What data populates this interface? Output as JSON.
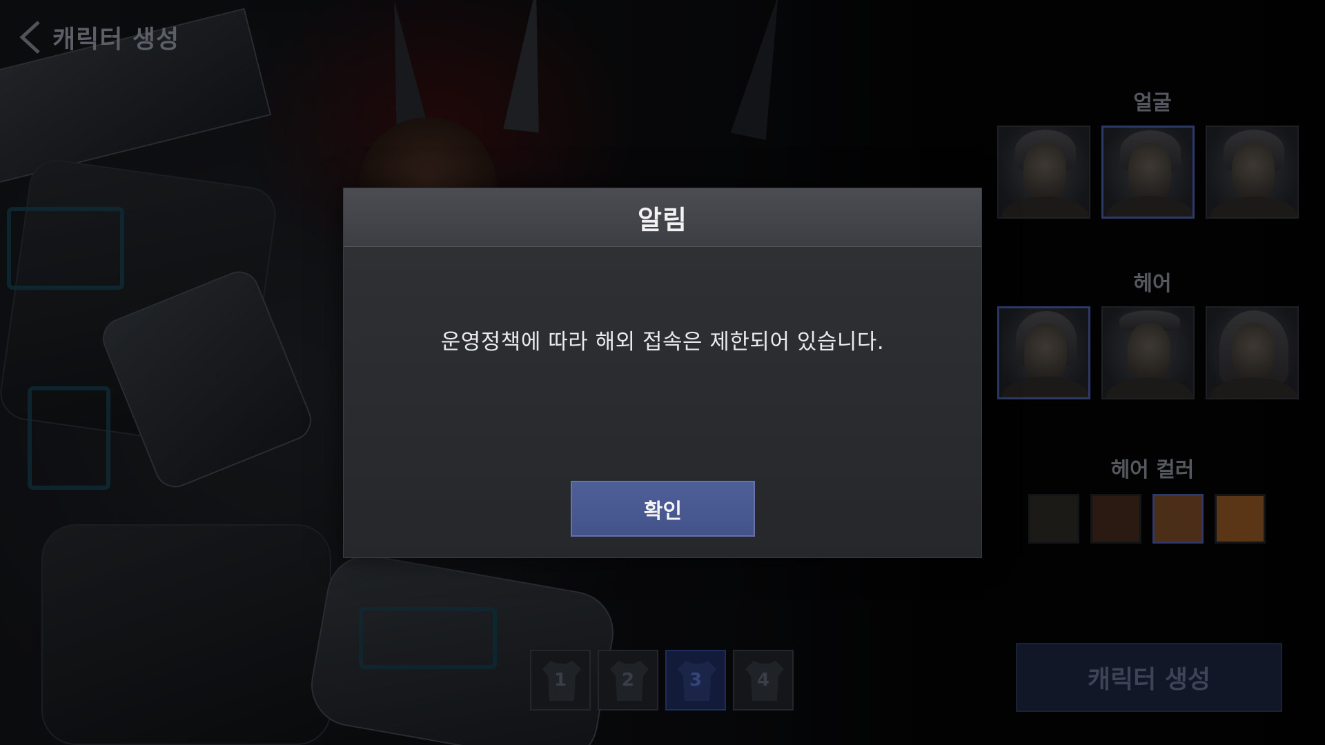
{
  "header": {
    "title": "캐릭터 생성",
    "back_icon": "chevron-left-icon"
  },
  "customize": {
    "face": {
      "label": "얼굴",
      "options": [
        "face-1",
        "face-2",
        "face-3"
      ],
      "selected_index": 1
    },
    "hair": {
      "label": "헤어",
      "options": [
        "hair-1",
        "hair-2",
        "hair-3"
      ],
      "selected_index": 0
    },
    "hair_color": {
      "label": "헤어 컬러",
      "colors": [
        "#1c1a17",
        "#2a1a12",
        "#4a2e18",
        "#5a3516"
      ],
      "selected_index": 2
    }
  },
  "armor_sets": {
    "items": [
      "1",
      "2",
      "3",
      "4"
    ],
    "selected_index": 2,
    "icon": "armor-icon"
  },
  "create_button": {
    "label": "캐릭터 생성"
  },
  "modal": {
    "title": "알림",
    "message": "운영정책에 따라 해외 접속은 제한되어 있습니다.",
    "confirm_label": "확인"
  },
  "colors": {
    "accent": "#4a5a92",
    "modal_bg": "#27282c",
    "modal_header": "#44464b"
  }
}
